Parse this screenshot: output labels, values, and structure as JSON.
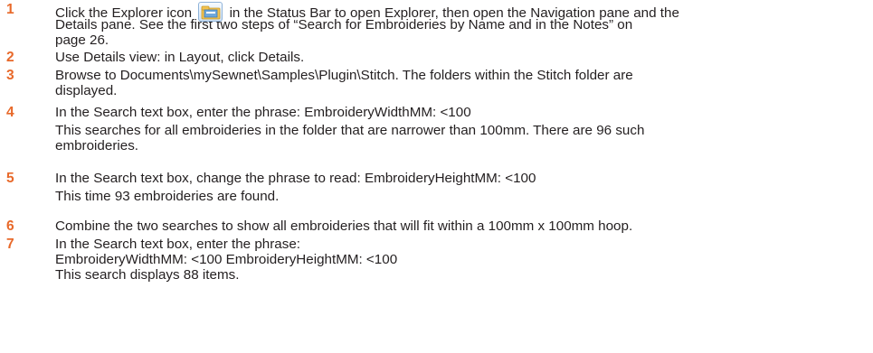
{
  "steps": [
    {
      "number": "1",
      "lines": [
        [
          "Click the Explorer icon",
          "in the Status Bar to open Explorer, then open the Navigation pane and the"
        ],
        "Details pane. See the first two steps of “Search for Embroideries by Name and in the Notes” on",
        "page 26."
      ],
      "icon": "explorer-icon"
    },
    {
      "number": "2",
      "lines": [
        "Use Details view: in Layout, click Details."
      ]
    },
    {
      "number": "3",
      "lines": [
        "Browse to Documents\\mySewnet\\Samples\\Plugin\\Stitch. The folders within the Stitch folder are",
        "displayed."
      ]
    },
    {
      "number": "4",
      "lines": [
        "In the Search text box, enter the phrase: EmbroideryWidthMM: <100",
        "This searches for all embroideries in the folder that are narrower than 100mm. There are 96 such",
        "embroideries."
      ]
    },
    {
      "number": "5",
      "lines": [
        "In the Search text box, change the phrase to read: EmbroideryHeightMM: <100",
        "This time 93 embroideries are found."
      ]
    },
    {
      "number": "6",
      "lines": [
        "Combine the two searches to show all embroideries that will fit within a 100mm x 100mm hoop."
      ]
    },
    {
      "number": "7",
      "lines": [
        "In the Search text box, enter the phrase:",
        "EmbroideryWidthMM: <100 EmbroideryHeightMM: <100",
        "This search displays 88 items."
      ]
    }
  ]
}
